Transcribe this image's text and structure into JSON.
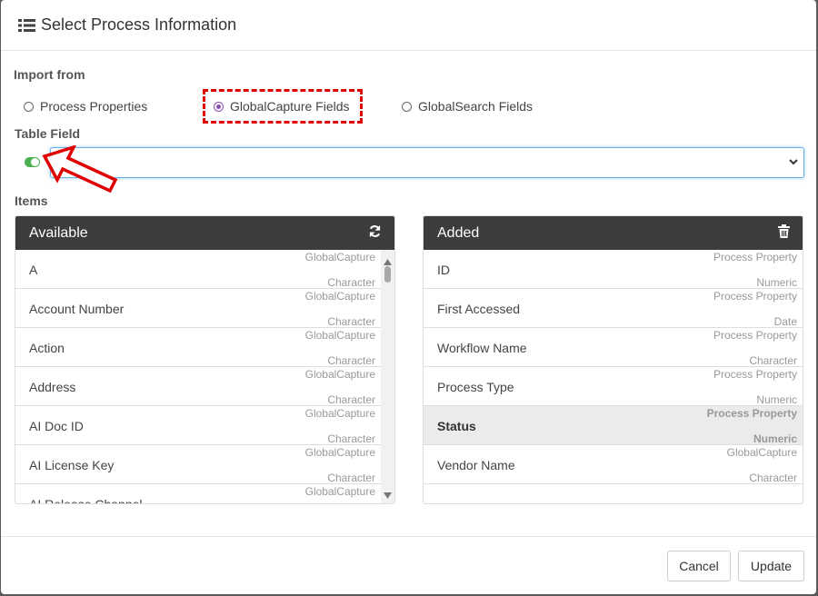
{
  "dialog": {
    "title": "Select Process Information",
    "title_icon": "list-icon"
  },
  "import_from": {
    "label": "Import from",
    "options": [
      {
        "label": "Process Properties",
        "checked": false
      },
      {
        "label": "GlobalCapture Fields",
        "checked": true
      },
      {
        "label": "GlobalSearch Fields",
        "checked": false
      }
    ]
  },
  "table_field": {
    "label": "Table Field",
    "toggle_on": true,
    "select_value": ""
  },
  "items_label": "Items",
  "available": {
    "title": "Available",
    "icon": "refresh-icon",
    "items": [
      {
        "name": "A",
        "source": "GlobalCapture",
        "type": "Character"
      },
      {
        "name": "Account Number",
        "source": "GlobalCapture",
        "type": "Character"
      },
      {
        "name": "Action",
        "source": "GlobalCapture",
        "type": "Character"
      },
      {
        "name": "Address",
        "source": "GlobalCapture",
        "type": "Character"
      },
      {
        "name": "AI Doc ID",
        "source": "GlobalCapture",
        "type": "Character"
      },
      {
        "name": "AI License Key",
        "source": "GlobalCapture",
        "type": "Character"
      },
      {
        "name": "AI Release Channel",
        "source": "GlobalCapture",
        "type": ""
      }
    ]
  },
  "added": {
    "title": "Added",
    "icon": "trash-icon",
    "items": [
      {
        "name": "ID",
        "source": "Process Property",
        "type": "Numeric"
      },
      {
        "name": "First Accessed",
        "source": "Process Property",
        "type": "Date"
      },
      {
        "name": "Workflow Name",
        "source": "Process Property",
        "type": "Character"
      },
      {
        "name": "Process Type",
        "source": "Process Property",
        "type": "Numeric"
      },
      {
        "name": "Status",
        "source": "Process Property",
        "type": "Numeric",
        "selected": true
      },
      {
        "name": "Vendor Name",
        "source": "GlobalCapture",
        "type": "Character"
      }
    ]
  },
  "footer": {
    "cancel_label": "Cancel",
    "update_label": "Update"
  },
  "colors": {
    "annotation_red": "#e00000",
    "radio_accent": "#8b4fb3",
    "toggle_green": "#4caf50",
    "panel_header": "#3c3c3c"
  }
}
